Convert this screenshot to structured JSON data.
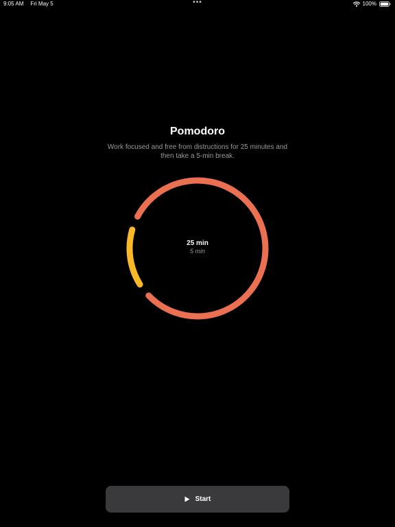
{
  "status_bar": {
    "time": "9:05 AM",
    "date": "Fri May 5",
    "center_dots": "•••",
    "battery": "100%"
  },
  "main": {
    "title": "Pomodoro",
    "description": "Work focused and free from distructions for 25 minutes and then take a 5-min break.",
    "work_duration": "25 min",
    "break_duration": "5 min",
    "start_label": "Start"
  },
  "timer": {
    "work_minutes": 25,
    "break_minutes": 5
  },
  "colors": {
    "work_arc": "#EB7051",
    "break_arc": "#FBB829",
    "button_bg": "#3A3A3C",
    "background": "#000000",
    "secondary_text": "#9A9A9A"
  },
  "icons": {
    "wifi": "wifi-icon",
    "battery": "battery-icon",
    "play": "play-icon"
  }
}
